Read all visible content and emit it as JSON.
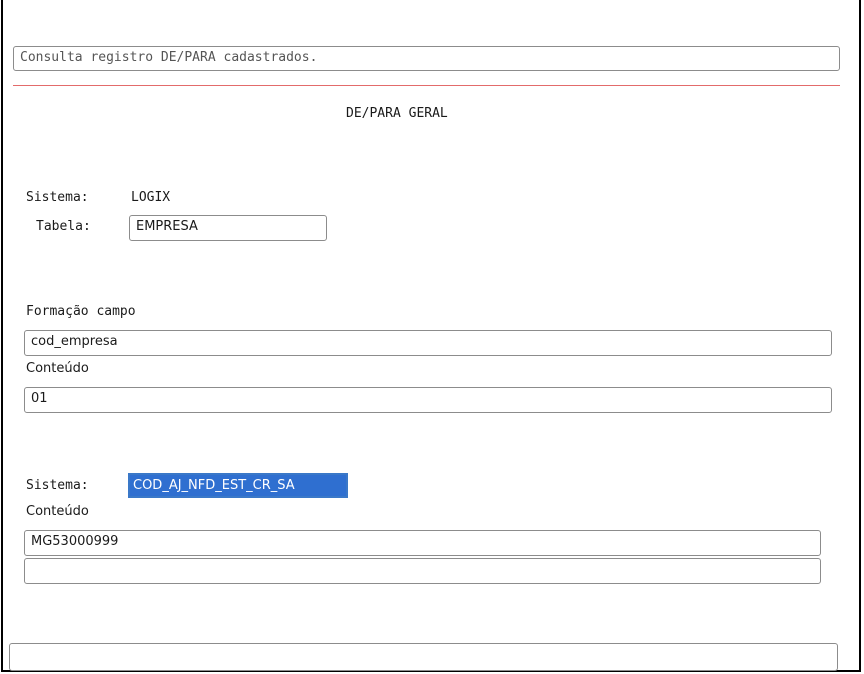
{
  "header": {
    "message": "Consulta registro DE/PARA cadastrados.",
    "title": "DE/PARA GERAL"
  },
  "origin": {
    "sistema_label": "Sistema:",
    "sistema_value": "LOGIX",
    "tabela_label": "Tabela:",
    "tabela_value": "EMPRESA"
  },
  "campo": {
    "formacao_label": "Formação campo",
    "formacao_value": "cod_empresa",
    "conteudo_label": "Conteúdo",
    "conteudo_value": "01"
  },
  "destino": {
    "sistema_label": "Sistema:",
    "sistema_value": "COD_AJ_NFD_EST_CR_SA",
    "conteudo_label": "Conteúdo",
    "conteudo_value": "MG53000999",
    "conteudo_value2": ""
  },
  "footer": {
    "status_value": ""
  }
}
